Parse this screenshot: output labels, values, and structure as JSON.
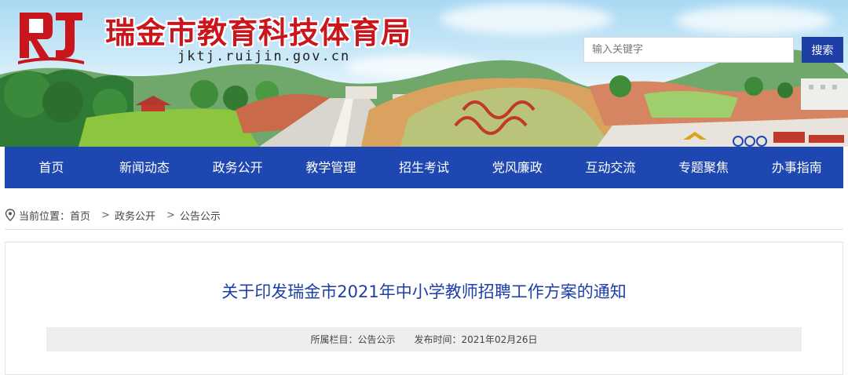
{
  "header": {
    "site_title": "瑞金市教育科技体育局",
    "site_domain": "jktj.ruijin.gov.cn",
    "logo_icon": "rj-logo-icon",
    "brand_color": "#c9161d"
  },
  "search": {
    "placeholder": "输入关键字",
    "button_label": "搜索"
  },
  "nav": {
    "color": "#1e47b2",
    "items": [
      "首页",
      "新闻动态",
      "政务公开",
      "教学管理",
      "招生考试",
      "党风廉政",
      "互动交流",
      "专题聚焦",
      "办事指南"
    ]
  },
  "breadcrumb": {
    "prefix": "当前位置：",
    "items": [
      "首页",
      "政务公开",
      "公告公示"
    ],
    "separator": ">"
  },
  "article": {
    "title": "关于印发瑞金市2021年中小学教师招聘工作方案的通知",
    "column": "所属栏目：公告公示",
    "published": "发布时间：2021年02月26日"
  }
}
